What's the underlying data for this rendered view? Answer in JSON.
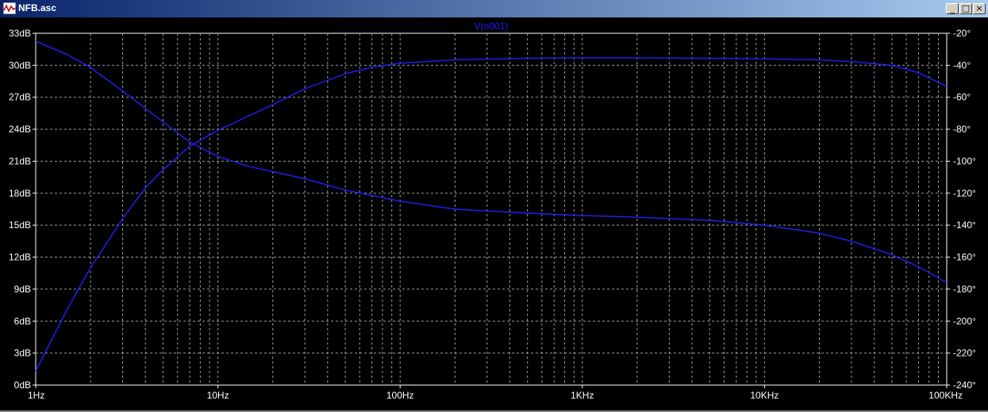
{
  "window": {
    "title": "NFB.asc",
    "controls": {
      "minimize": "_",
      "maximize": "□",
      "close": "×"
    }
  },
  "colors": {
    "background": "#000000",
    "grid": "#9a9a9a",
    "trace": "#2020ff",
    "labels": "#ffffff",
    "title_bar": "#0a246a"
  },
  "chart_data": {
    "type": "line",
    "title": "V(n001)",
    "x_scale": "log",
    "xlim": [
      1,
      100000
    ],
    "x_ticks": [
      "1Hz",
      "10Hz",
      "100Hz",
      "1KHz",
      "10KHz",
      "100KHz"
    ],
    "y_left": {
      "range": [
        0,
        33
      ],
      "ticks": [
        "0dB",
        "3dB",
        "6dB",
        "9dB",
        "12dB",
        "15dB",
        "18dB",
        "21dB",
        "24dB",
        "27dB",
        "30dB",
        "33dB"
      ]
    },
    "y_right": {
      "range": [
        -240,
        -20
      ],
      "ticks": [
        "-240°",
        "-220°",
        "-200°",
        "-180°",
        "-160°",
        "-140°",
        "-120°",
        "-100°",
        "-80°",
        "-60°",
        "-40°",
        "-20°"
      ]
    },
    "grid": true,
    "series": [
      {
        "axis": "left",
        "x": [
          1,
          1.5,
          2,
          3,
          4,
          5,
          7,
          10,
          15,
          20,
          30,
          50,
          70,
          100,
          200,
          500,
          1000,
          2000,
          5000,
          10000,
          20000,
          30000,
          50000,
          70000,
          100000
        ],
        "y": [
          1.3,
          7.2,
          11.0,
          15.6,
          18.5,
          20.2,
          22.4,
          23.9,
          25.3,
          26.3,
          27.8,
          29.2,
          29.8,
          30.2,
          30.5,
          30.65,
          30.7,
          30.7,
          30.65,
          30.6,
          30.5,
          30.35,
          30.0,
          29.3,
          28.0
        ]
      },
      {
        "axis": "right",
        "x": [
          1,
          1.5,
          2,
          3,
          5,
          7,
          10,
          15,
          20,
          30,
          50,
          100,
          200,
          500,
          1000,
          2000,
          5000,
          10000,
          20000,
          30000,
          50000,
          70000,
          100000
        ],
        "y": [
          -25.0,
          -33.5,
          -41.5,
          -56.0,
          -75.5,
          -88.0,
          -97.0,
          -103.5,
          -106.5,
          -111.0,
          -118.0,
          -125.0,
          -130.0,
          -132.5,
          -134.0,
          -135.0,
          -137.0,
          -140.0,
          -145.0,
          -150.0,
          -158.5,
          -166.0,
          -176.0
        ]
      }
    ]
  }
}
